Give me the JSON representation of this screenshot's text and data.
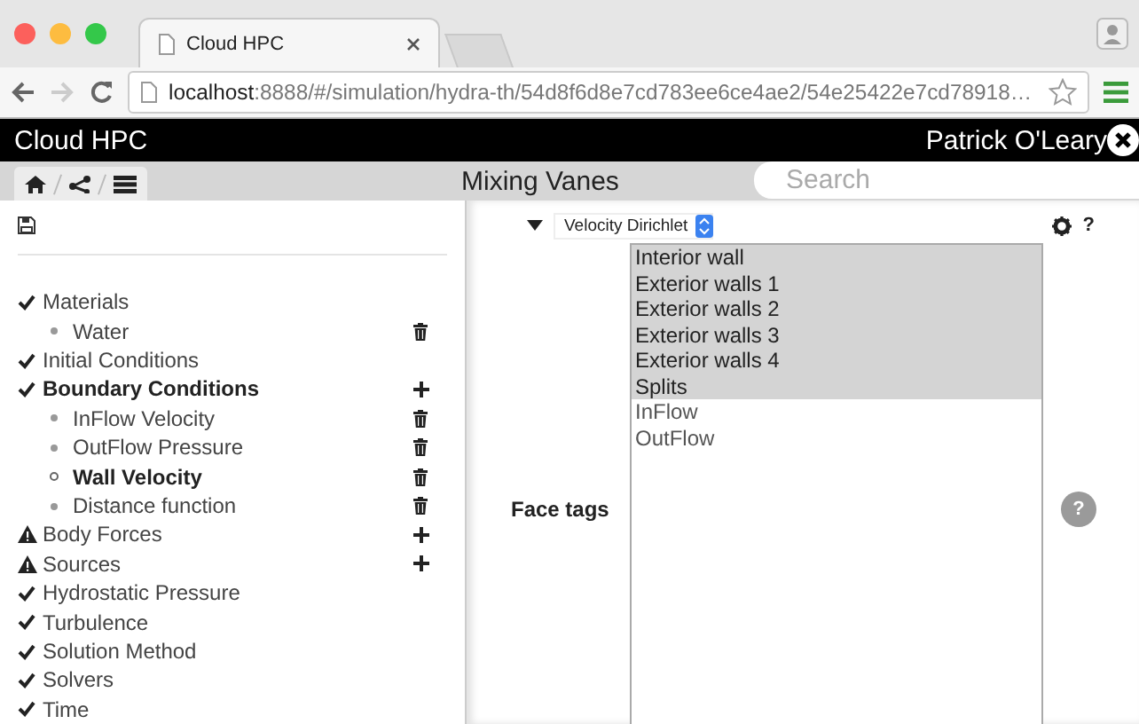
{
  "browser": {
    "tab_title": "Cloud HPC",
    "url": "**localhost**:8888/#/simulation/hydra-th/54d8f6d8e7cd783ee6ce4ae2/54e25422e7cd78918…"
  },
  "app": {
    "title": "Cloud HPC",
    "user": "Patrick O'Leary"
  },
  "page": {
    "title": "Mixing Vanes",
    "search": {
      "placeholder": "Search"
    }
  },
  "tree": [
    {
      "label": "Materials",
      "warning": false,
      "selected": false,
      "add_button": false,
      "children": [
        {
          "label": "Water",
          "selected": false,
          "delete_button": true
        }
      ]
    },
    {
      "label": "Initial Conditions",
      "warning": false,
      "selected": false,
      "add_button": false
    },
    {
      "label": "Boundary Conditions",
      "warning": false,
      "selected": true,
      "add_button": true,
      "children": [
        {
          "label": "InFlow Velocity",
          "selected": false,
          "delete_button": true
        },
        {
          "label": "OutFlow Pressure",
          "selected": false,
          "delete_button": true
        },
        {
          "label": "Wall Velocity",
          "selected": true,
          "delete_button": true
        },
        {
          "label": "Distance function",
          "selected": false,
          "delete_button": true
        }
      ]
    },
    {
      "label": "Body Forces",
      "warning": true,
      "selected": false,
      "add_button": true
    },
    {
      "label": "Sources",
      "warning": true,
      "selected": false,
      "add_button": true
    },
    {
      "label": "Hydrostatic Pressure",
      "warning": false,
      "selected": false,
      "add_button": false
    },
    {
      "label": "Turbulence",
      "warning": false,
      "selected": false,
      "add_button": false
    },
    {
      "label": "Solution Method",
      "warning": false,
      "selected": false,
      "add_button": false
    },
    {
      "label": "Solvers",
      "warning": false,
      "selected": false,
      "add_button": false
    },
    {
      "label": "Time",
      "warning": false,
      "selected": false,
      "add_button": false
    }
  ],
  "form": {
    "type_select": "Velocity Dirichlet",
    "help_mark": "?",
    "field_label": "Face tags",
    "hint_mark": "?",
    "options": [
      {
        "label": "Interior wall",
        "selected": true
      },
      {
        "label": "Exterior walls 1",
        "selected": true
      },
      {
        "label": "Exterior walls 2",
        "selected": true
      },
      {
        "label": "Exterior walls 3",
        "selected": true
      },
      {
        "label": "Exterior walls 4",
        "selected": true
      },
      {
        "label": "Splits",
        "selected": true
      },
      {
        "label": "InFlow",
        "selected": false
      },
      {
        "label": "OutFlow",
        "selected": false
      }
    ]
  }
}
